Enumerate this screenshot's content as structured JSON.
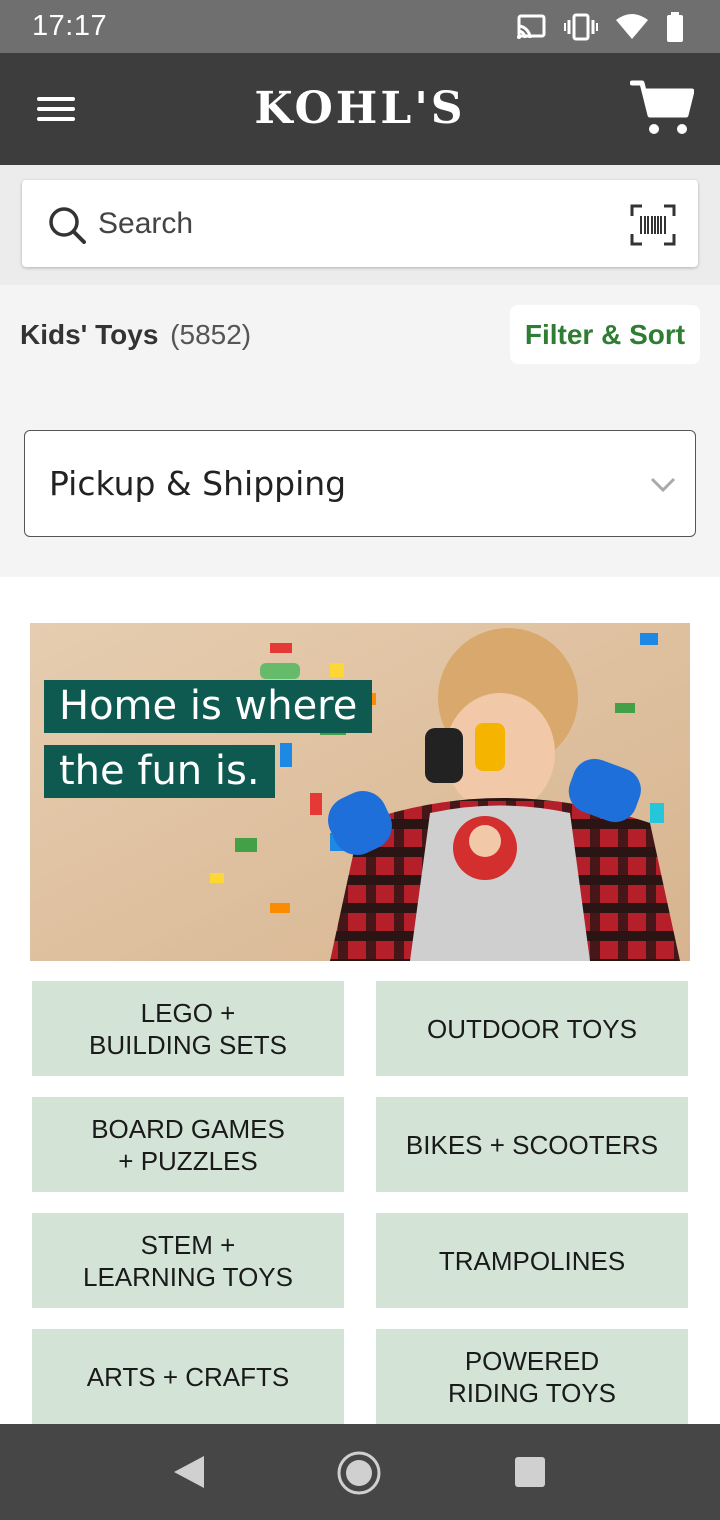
{
  "status_bar": {
    "time": "17:17",
    "icons": [
      "cast-icon",
      "vibrate-icon",
      "wifi-icon",
      "battery-icon"
    ]
  },
  "header": {
    "logo_text": "KOHL'S",
    "menu_icon": "hamburger-menu-icon",
    "cart_icon": "cart-icon"
  },
  "search": {
    "placeholder": "Search",
    "icon": "search-icon",
    "scan_icon": "barcode-scan-icon"
  },
  "category": {
    "title": "Kids' Toys",
    "count": "(5852)",
    "filter_sort_label": "Filter & Sort",
    "accent_color": "#2e7d32"
  },
  "pickup_dropdown": {
    "label": "Pickup & Shipping"
  },
  "hero": {
    "headline_line1": "Home is where",
    "headline_line2": "the fun is.",
    "headline_bg": "#0e5a50"
  },
  "categories": [
    {
      "label": "LEGO +\nBUILDING SETS"
    },
    {
      "label": "OUTDOOR TOYS"
    },
    {
      "label": "BOARD GAMES\n+ PUZZLES"
    },
    {
      "label": "BIKES + SCOOTERS"
    },
    {
      "label": "STEM +\nLEARNING TOYS"
    },
    {
      "label": "TRAMPOLINES"
    },
    {
      "label": "ARTS + CRAFTS"
    },
    {
      "label": "POWERED\nRIDING TOYS"
    }
  ],
  "tile_color": "#d3e3d6",
  "nav_bar": {
    "icons": [
      "back-icon",
      "home-icon",
      "recents-icon"
    ]
  }
}
